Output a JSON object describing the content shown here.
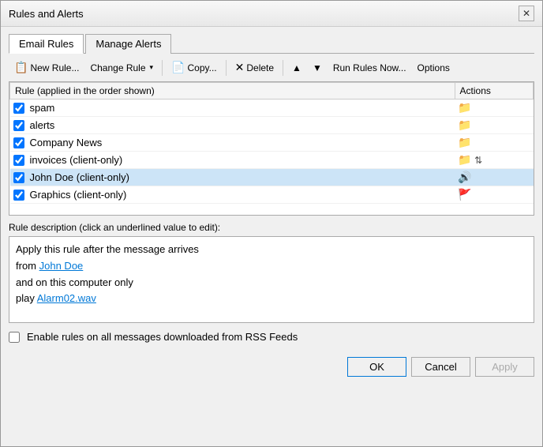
{
  "dialog": {
    "title": "Rules and Alerts",
    "close_label": "✕"
  },
  "tabs": [
    {
      "id": "email-rules",
      "label": "Email Rules",
      "active": true
    },
    {
      "id": "manage-alerts",
      "label": "Manage Alerts",
      "active": false
    }
  ],
  "toolbar": {
    "new_rule_label": "New Rule...",
    "change_rule_label": "Change Rule",
    "copy_label": "Copy...",
    "delete_label": "Delete",
    "move_up_label": "▲",
    "move_down_label": "▼",
    "run_rules_label": "Run Rules Now...",
    "options_label": "Options"
  },
  "rules_table": {
    "col_rule": "Rule (applied in the order shown)",
    "col_actions": "Actions",
    "rows": [
      {
        "id": "spam",
        "checked": true,
        "label": "spam",
        "action": "folder",
        "selected": false
      },
      {
        "id": "alerts",
        "checked": true,
        "label": "alerts",
        "action": "folder",
        "selected": false
      },
      {
        "id": "company-news",
        "checked": true,
        "label": "Company News",
        "action": "folder",
        "selected": false
      },
      {
        "id": "invoices",
        "checked": true,
        "label": "invoices  (client-only)",
        "action": "folder-sort",
        "selected": false
      },
      {
        "id": "john-doe",
        "checked": true,
        "label": "John Doe  (client-only)",
        "action": "sound",
        "selected": true
      },
      {
        "id": "graphics",
        "checked": true,
        "label": "Graphics  (client-only)",
        "action": "flag",
        "selected": false
      }
    ]
  },
  "rule_description": {
    "label": "Rule description (click an underlined value to edit):",
    "line1": "Apply this rule after the message arrives",
    "line2_prefix": "from ",
    "line2_link": "John Doe",
    "line3": "and on this computer only",
    "line4_prefix": "play ",
    "line4_link": "Alarm02.wav"
  },
  "rss_checkbox": {
    "label": "Enable rules on all messages downloaded from RSS Feeds",
    "checked": false
  },
  "footer": {
    "ok_label": "OK",
    "cancel_label": "Cancel",
    "apply_label": "Apply"
  }
}
